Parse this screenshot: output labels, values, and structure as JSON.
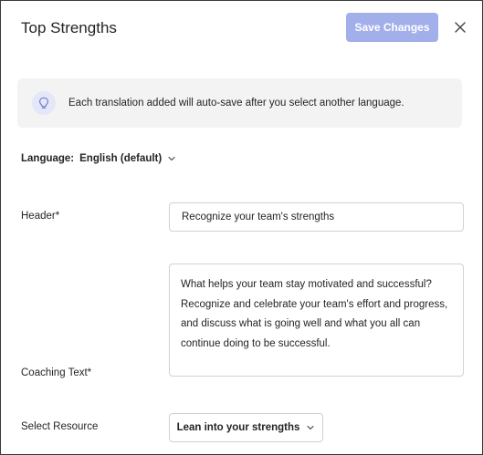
{
  "header": {
    "title": "Top Strengths",
    "save_label": "Save Changes",
    "close_icon": "close-icon"
  },
  "banner": {
    "icon": "lightbulb-icon",
    "text": "Each translation added will auto-save after you select another language."
  },
  "language": {
    "label": "Language:",
    "value": "English (default)"
  },
  "form": {
    "header_label": "Header*",
    "header_value": "Recognize your team's strengths",
    "coaching_label": "Coaching Text*",
    "coaching_value": "What helps your team stay motivated and successful? Recognize and celebrate your team's effort and progress, and discuss what is going well and what you all can continue doing to be successful.",
    "resource_label": "Select Resource",
    "resource_value": "Lean into your strengths"
  },
  "colors": {
    "primary_disabled": "#a3afea",
    "banner_bg": "#f3f3f3",
    "icon_circle": "#e4e7f8",
    "icon_stroke": "#5b6bcf"
  }
}
